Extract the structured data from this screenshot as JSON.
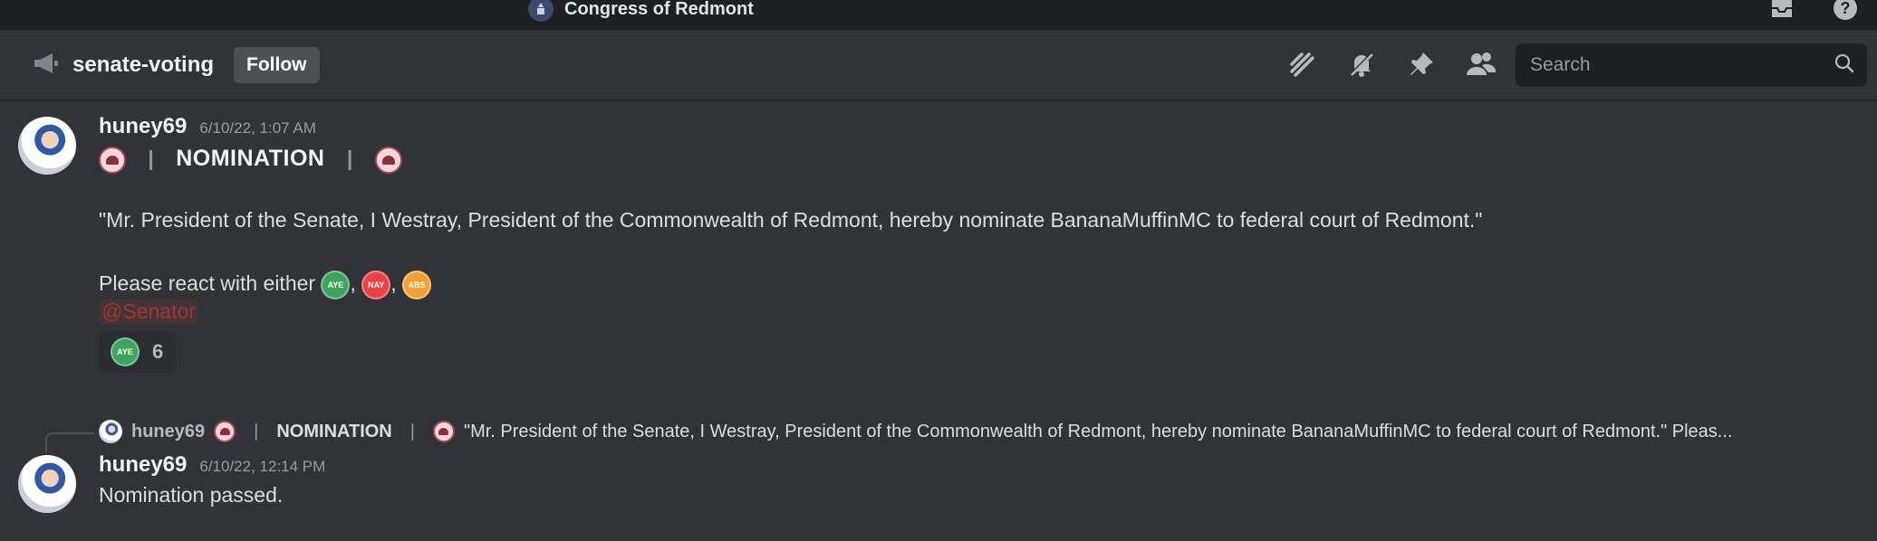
{
  "titlebar": {
    "server_name": "Congress of Redmont",
    "server_icon": "capitol-icon",
    "icons": [
      "inbox-icon",
      "help-icon"
    ]
  },
  "channel": {
    "name": "senate-voting",
    "icon": "announcement-megaphone-icon",
    "follow_label": "Follow",
    "header_icons": [
      "threads-icon",
      "mute-bell-icon",
      "pin-icon",
      "members-icon"
    ],
    "search_placeholder": "Search"
  },
  "messages": [
    {
      "author": "huney69",
      "timestamp": "6/10/22, 1:07 AM",
      "header_title": "NOMINATION",
      "quote": "\"Mr. President of the Senate, I Westray, President of the Commonwealth of Redmont, hereby nominate BananaMuffinMC to federal court of Redmont.\"",
      "react_prompt": "Please react with either",
      "react_options": [
        {
          "label": "AYE",
          "color": "#3ba55c"
        },
        {
          "label": "NAY",
          "color": "#ed4245"
        },
        {
          "label": "ABS",
          "color": "#f0a132"
        }
      ],
      "mention": "@Senator",
      "reaction": {
        "emoji": "AYE",
        "count": "6"
      }
    },
    {
      "reply": {
        "author": "huney69",
        "title": "NOMINATION",
        "text": "\"Mr. President of the Senate, I Westray, President of the Commonwealth of Redmont, hereby nominate BananaMuffinMC to federal court of Redmont.\"  Pleas..."
      },
      "author": "huney69",
      "timestamp": "6/10/22, 12:14 PM",
      "text": "Nomination passed."
    }
  ],
  "colors": {
    "background": "#313338",
    "titlebar": "#1e1f22",
    "mention": "#a03535",
    "aye": "#3ba55c",
    "nay": "#ed4245",
    "abs": "#f0a132"
  }
}
